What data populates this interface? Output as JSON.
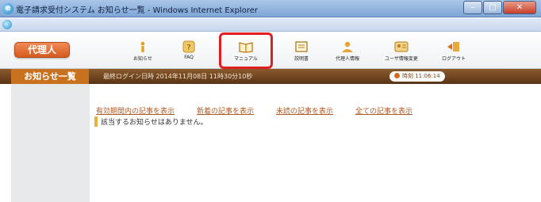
{
  "window": {
    "title": "電子請求受付システム お知らせ一覧 - Windows Internet Explorer"
  },
  "header": {
    "role_label": "代理人",
    "menu": [
      {
        "name": "お知らせ",
        "icon": "info-icon"
      },
      {
        "name": "FAQ",
        "icon": "faq-icon"
      },
      {
        "name": "マニュアル",
        "icon": "book-icon",
        "highlighted": true
      },
      {
        "name": "説明書",
        "icon": "document-icon"
      },
      {
        "name": "代理人情報",
        "icon": "person-icon"
      },
      {
        "name": "ユーザ情報変更",
        "icon": "user-card-icon"
      },
      {
        "name": "ログアウト",
        "icon": "logout-icon"
      }
    ]
  },
  "status": {
    "page_title": "お知らせ一覧",
    "last_login": "最終ログイン日時 2014年11月08日 11時30分10秒",
    "clock": "時刻 11:06:14"
  },
  "main": {
    "filters": [
      "有効期間内の記事を表示",
      "新着の記事を表示",
      "未読の記事を表示",
      "全ての記事を表示"
    ],
    "message": "該当するお知らせはありません。"
  },
  "colors": {
    "accent_orange": "#d45a1e",
    "status_bar_brown": "#5a3416",
    "highlight_red": "#e02020",
    "link_color": "#ae5b25"
  }
}
